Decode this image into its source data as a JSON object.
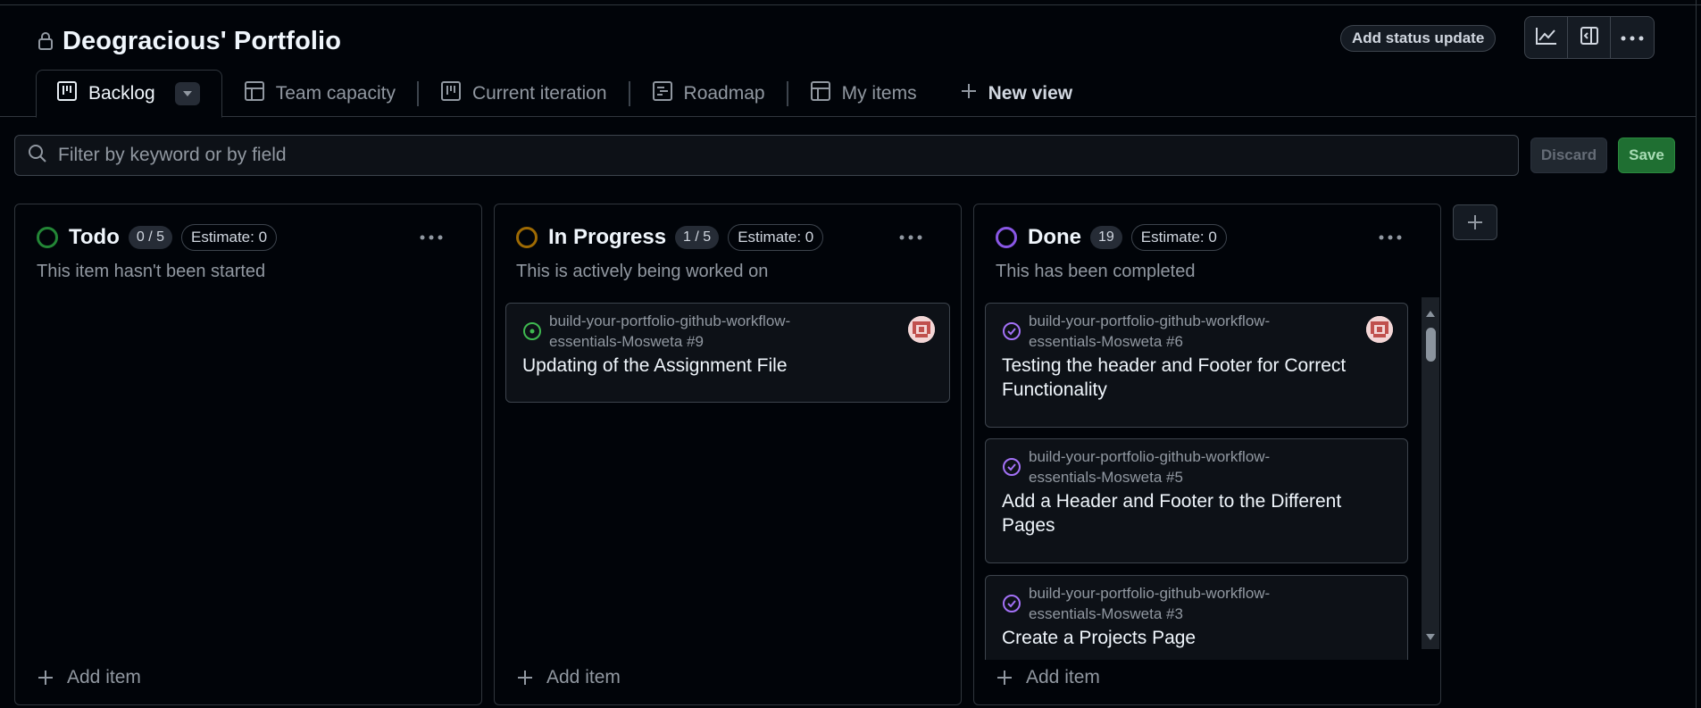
{
  "header": {
    "title": "Deogracious' Portfolio",
    "status_button": "Add status update"
  },
  "tabs": [
    {
      "label": "Backlog",
      "icon": "board-icon",
      "active": true
    },
    {
      "label": "Team capacity",
      "icon": "table-icon"
    },
    {
      "label": "Current iteration",
      "icon": "board-icon"
    },
    {
      "label": "Roadmap",
      "icon": "roadmap-icon"
    },
    {
      "label": "My items",
      "icon": "table-icon"
    },
    {
      "label": "New view",
      "icon": "plus-icon"
    }
  ],
  "filter": {
    "placeholder": "Filter by keyword or by field",
    "discard_label": "Discard",
    "save_label": "Save"
  },
  "columns": [
    {
      "name": "Todo",
      "color": "#3fb950",
      "count": "0 / 5",
      "estimate": "Estimate: 0",
      "description": "This item hasn't been started",
      "add_label": "Add item",
      "cards": []
    },
    {
      "name": "In Progress",
      "color": "#d29922",
      "count": "1 / 5",
      "estimate": "Estimate: 0",
      "description": "This is actively being worked on",
      "add_label": "Add item",
      "cards": [
        {
          "repo_line1": "build-your-portfolio-github-workflow-",
          "repo_line2": "essentials-Mosweta #9",
          "title": "Updating of the Assignment File",
          "status": "open"
        }
      ]
    },
    {
      "name": "Done",
      "color": "#a371f7",
      "count": "19",
      "estimate": "Estimate: 0",
      "description": "This has been completed",
      "add_label": "Add item",
      "cards": [
        {
          "repo_line1": "build-your-portfolio-github-workflow-",
          "repo_line2": "essentials-Mosweta #6",
          "title": "Testing the header and Footer for Correct Functionality",
          "status": "closed"
        },
        {
          "repo_line1": "build-your-portfolio-github-workflow-",
          "repo_line2": "essentials-Mosweta #5",
          "title": "Add a Header and Footer to the Different Pages",
          "status": "closed"
        },
        {
          "repo_line1": "build-your-portfolio-github-workflow-",
          "repo_line2": "essentials-Mosweta #3",
          "title": "Create a Projects Page",
          "status": "closed"
        }
      ]
    }
  ],
  "colors": {
    "background": "#010409",
    "border": "#30363d",
    "save_green": "#1f6f32"
  }
}
